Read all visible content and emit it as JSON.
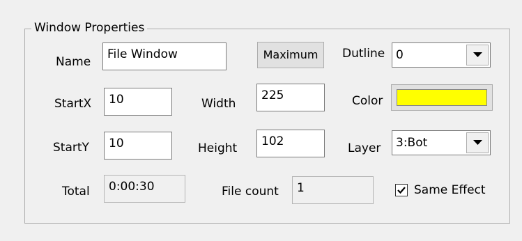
{
  "group": {
    "title": "Window Properties"
  },
  "row1": {
    "name_label": "Name",
    "name_value": "File Window",
    "maximum_button": "Maximum",
    "outline_label": "Dutline",
    "outline_value": "0"
  },
  "row2": {
    "startx_label": "StartX",
    "startx_value": "10",
    "width_label": "Width",
    "width_value": "225",
    "color_label": "Color",
    "color_value": "#ffff00"
  },
  "row3": {
    "starty_label": "StartY",
    "starty_value": "10",
    "height_label": "Height",
    "height_value": "102",
    "layer_label": "Layer",
    "layer_value": "3:Bot"
  },
  "row4": {
    "total_label": "Total",
    "total_value": "0:00:30",
    "filecount_label": "File count",
    "filecount_value": "1",
    "same_effect_label": "Same Effect",
    "same_effect_checked": true
  },
  "icons": {
    "dropdown_arrow": "chevron-down-icon",
    "checkmark": "checkmark-icon"
  }
}
